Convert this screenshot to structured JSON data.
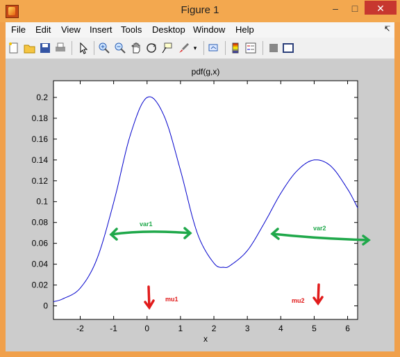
{
  "window": {
    "title": "Figure 1",
    "minimize": "–",
    "maximize": "□",
    "close": "✕"
  },
  "menu": {
    "file": "File",
    "edit": "Edit",
    "view": "View",
    "insert": "Insert",
    "tools": "Tools",
    "desktop": "Desktop",
    "window": "Window",
    "help": "Help"
  },
  "toolbar_icons": [
    "new-figure-icon",
    "open-file-icon",
    "save-icon",
    "print-icon",
    "pointer-icon",
    "zoom-in-icon",
    "zoom-out-icon",
    "pan-icon",
    "rotate-icon",
    "data-cursor-icon",
    "brush-icon",
    "link-plot-icon",
    "colorbar-icon",
    "legend-icon",
    "hide-plot-tools-icon",
    "show-plot-tools-icon"
  ],
  "chart_data": {
    "type": "line",
    "title": "pdf(g,x)",
    "xlabel": "x",
    "ylabel": "",
    "xlim": [
      -2.8,
      6.3
    ],
    "ylim": [
      -0.013,
      0.216
    ],
    "xticks": [
      -2,
      -1,
      0,
      1,
      2,
      3,
      4,
      5,
      6
    ],
    "yticks": [
      0,
      0.02,
      0.04,
      0.06,
      0.08,
      0.1,
      0.12,
      0.14,
      0.16,
      0.18,
      0.2
    ],
    "series": [
      {
        "color": "#0000cc",
        "x": [
          -2.8,
          -2.5,
          -2.0,
          -1.5,
          -1.0,
          -0.5,
          0.0,
          0.5,
          1.0,
          1.5,
          2.0,
          2.3,
          2.5,
          3.0,
          3.5,
          4.0,
          4.5,
          5.0,
          5.5,
          6.0,
          6.3
        ],
        "y": [
          0.004,
          0.007,
          0.017,
          0.045,
          0.099,
          0.164,
          0.2,
          0.183,
          0.13,
          0.07,
          0.041,
          0.037,
          0.039,
          0.053,
          0.079,
          0.108,
          0.13,
          0.14,
          0.134,
          0.112,
          0.094
        ]
      }
    ],
    "annotations": {
      "var1": "var1",
      "var2": "var2",
      "mu1": "mu1",
      "mu2": "mu2",
      "green": "#1fa84a",
      "red": "#e11b1b"
    },
    "grid": false
  }
}
